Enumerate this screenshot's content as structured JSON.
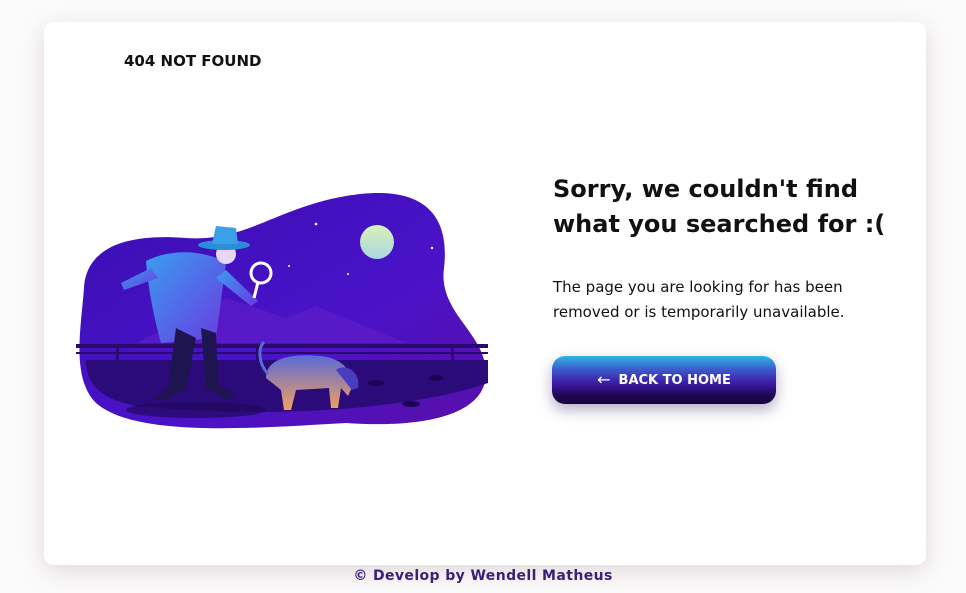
{
  "header": {
    "title": "404 NOT FOUND"
  },
  "main": {
    "headline": "Sorry, we couldn't find what you searched for :(",
    "message": "The page you are looking for has been removed or is temporarily unavailable.",
    "back_button": {
      "label": "BACK TO HOME",
      "icon": "arrow-left-icon"
    },
    "illustration": {
      "subject": "detective-with-magnifier-and-dog-icon"
    }
  },
  "footer": {
    "text": "© Develop by Wendell Matheus"
  },
  "colors": {
    "accent_dark": "#14033a",
    "accent_purple": "#3b1aa3",
    "accent_blue": "#2eb5e5",
    "footer_text": "#3b1d7a"
  }
}
